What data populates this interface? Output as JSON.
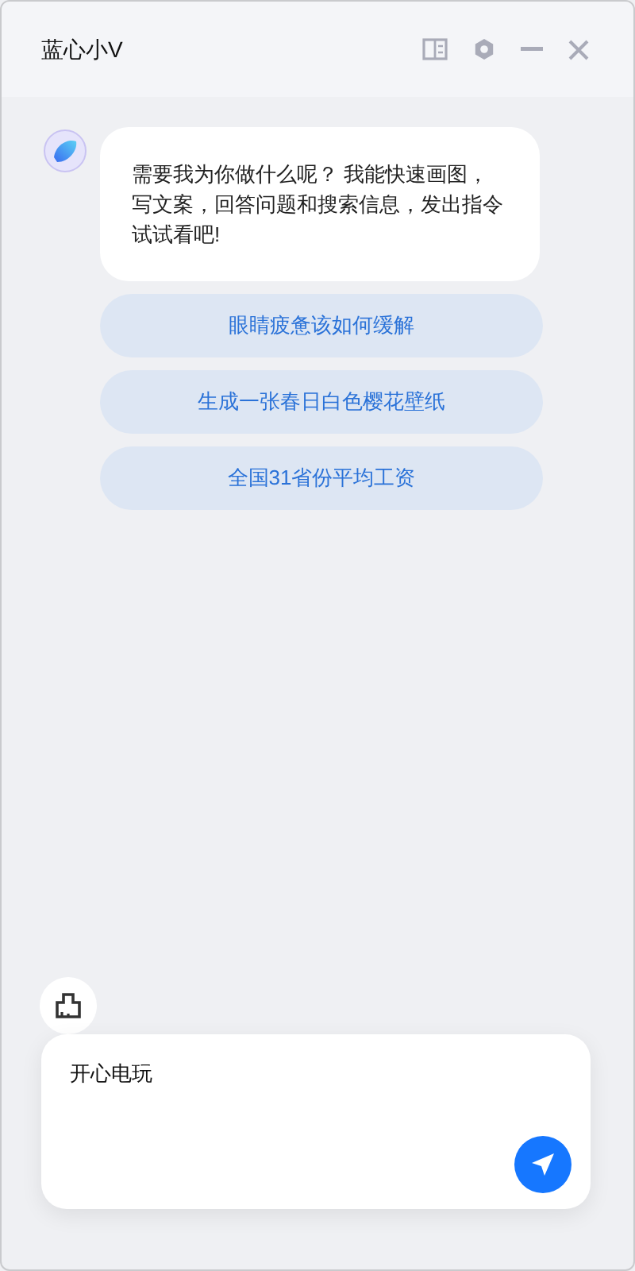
{
  "window": {
    "title": "蓝心小V"
  },
  "message": {
    "text": "需要我为你做什么呢？ 我能快速画图，写文案，回答问题和搜索信息，发出指令试试看吧!"
  },
  "suggestions": [
    "眼睛疲惫该如何缓解",
    "生成一张春日白色樱花壁纸",
    "全国31省份平均工资"
  ],
  "input": {
    "value": "开心电玩"
  }
}
